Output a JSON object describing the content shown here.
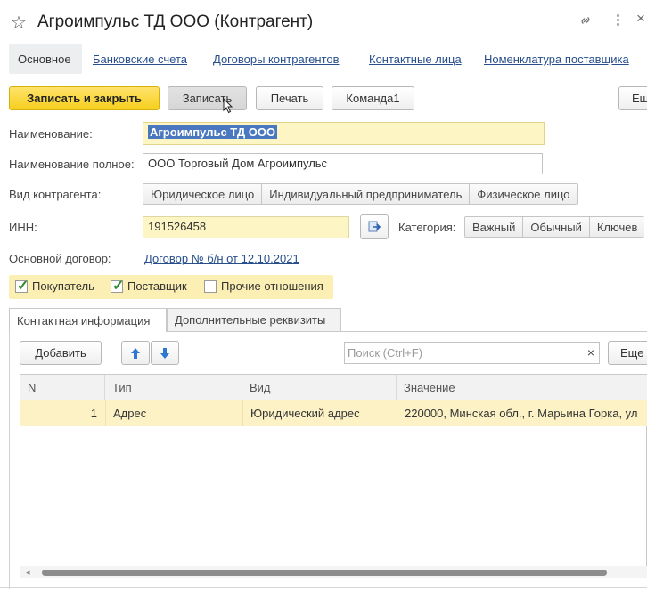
{
  "header": {
    "title": "Агроимпульс ТД ООО (Контрагент)",
    "star_icon": "star-icon",
    "link_icon": "link-icon",
    "more_icon": "more-vert-icon",
    "close_icon": "close-icon"
  },
  "nav": {
    "main": "Основное",
    "links": [
      "Банковские счета",
      "Договоры контрагентов",
      "Контактные лица",
      "Номенклатура поставщика"
    ]
  },
  "toolbar": {
    "save_close": "Записать и закрыть",
    "save": "Записать",
    "print": "Печать",
    "command1": "Команда1",
    "more": "Ещ"
  },
  "form": {
    "name_label": "Наименование:",
    "name_value": "Агроимпульс ТД ООО",
    "fullname_label": "Наименование полное:",
    "fullname_value": "ООО Торговый Дом Агроимпульс",
    "kind_label": "Вид контрагента:",
    "kinds": [
      "Юридическое лицо",
      "Индивидуальный предприниматель",
      "Физическое лицо"
    ],
    "inn_label": "ИНН:",
    "inn_value": "191526458",
    "category_label": "Категория:",
    "categories": [
      "Важный",
      "Обычный",
      "Ключев"
    ],
    "contract_label": "Основной договор:",
    "contract_value": "Договор № б/н от 12.10.2021"
  },
  "checks": {
    "buyer": "Покупатель",
    "supplier": "Поставщик",
    "other": "Прочие отношения",
    "buyer_checked": true,
    "supplier_checked": true,
    "other_checked": false
  },
  "tabs": [
    "Контактная информация",
    "Дополнительные реквизиты"
  ],
  "table_toolbar": {
    "add": "Добавить",
    "search_placeholder": "Поиск (Ctrl+F)",
    "clear": "×",
    "more": "Еще"
  },
  "table": {
    "headers": [
      "N",
      "Тип",
      "Вид",
      "Значение"
    ],
    "rows": [
      {
        "n": "1",
        "type": "Адрес",
        "kind": "Юридический адрес",
        "value": "220000, Минская обл., г. Марьина Горка, ул"
      }
    ]
  },
  "colors": {
    "accent_yellow": "#f6cf1e",
    "field_yellow": "#fdf5c4",
    "link_blue": "#284f8c",
    "row_highlight": "#fcf2c5"
  }
}
